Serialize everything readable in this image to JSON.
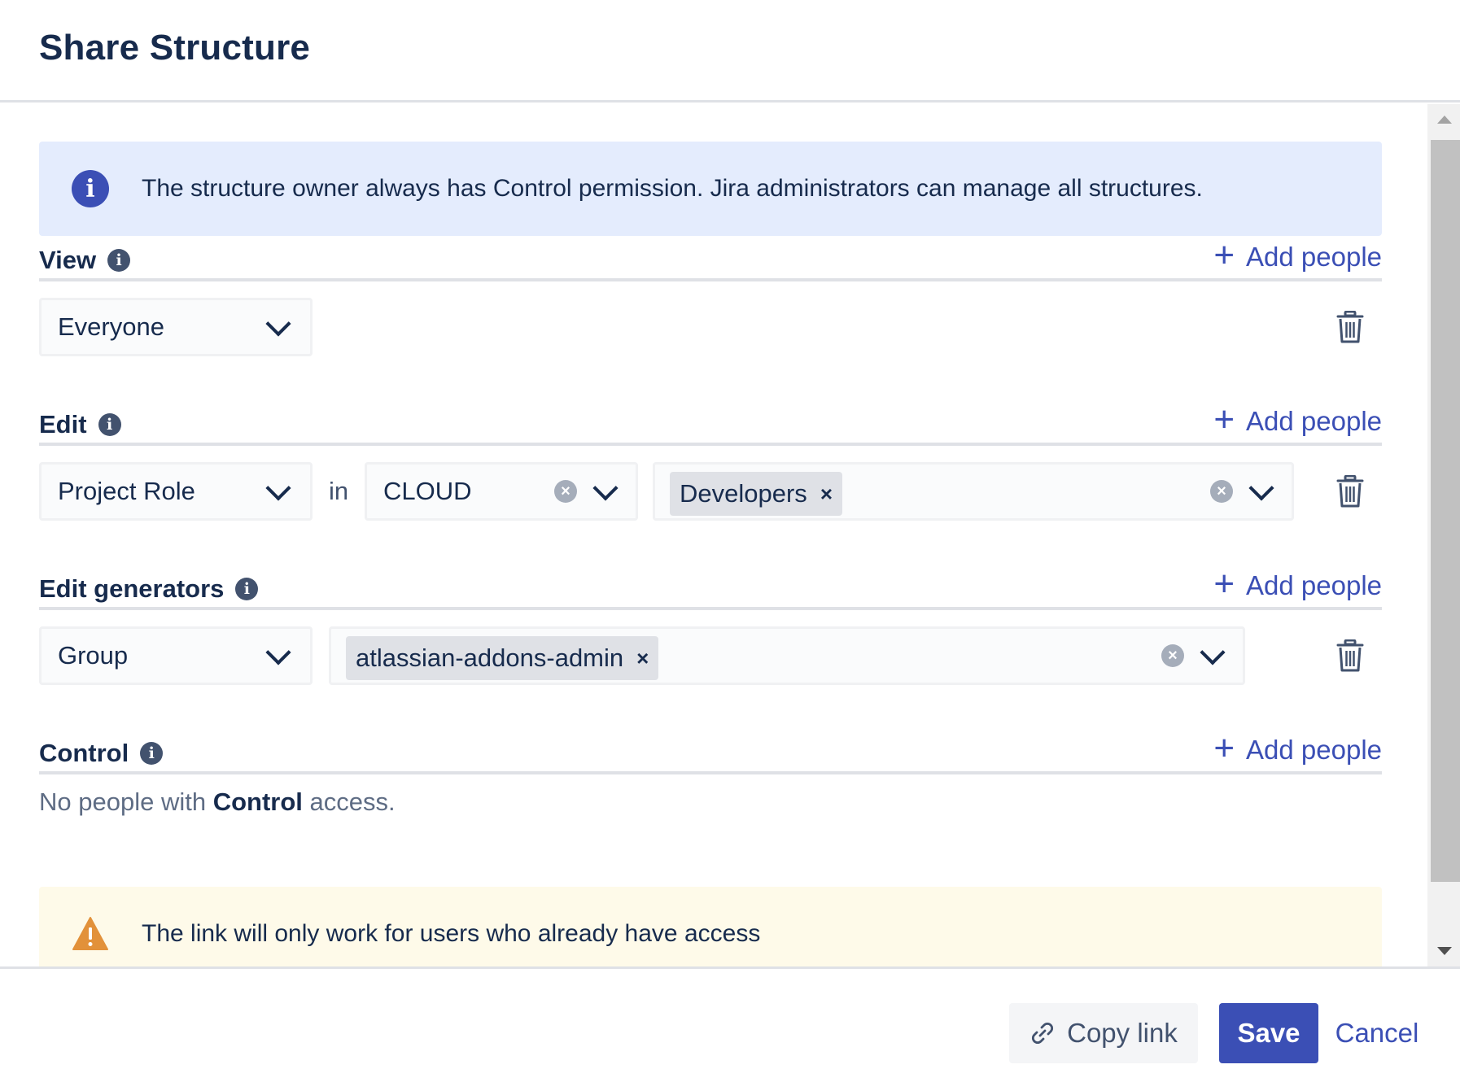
{
  "dialog": {
    "title": "Share Structure"
  },
  "info_banner": {
    "text": "The structure owner always has Control permission. Jira administrators can manage all structures."
  },
  "sections": {
    "view": {
      "title": "View",
      "add_label": "Add people",
      "type_select": "Everyone"
    },
    "edit": {
      "title": "Edit",
      "add_label": "Add people",
      "type_select": "Project Role",
      "in_label": "in",
      "project_select": "CLOUD",
      "role_tag": "Developers",
      "tag_remove": "×"
    },
    "edit_generators": {
      "title": "Edit generators",
      "add_label": "Add people",
      "type_select": "Group",
      "group_tag": "atlassian-addons-admin",
      "tag_remove": "×"
    },
    "control": {
      "title": "Control",
      "add_label": "Add people",
      "empty_prefix": "No people with",
      "empty_bold": "Control",
      "empty_suffix": "access."
    }
  },
  "warning_banner": {
    "text": "The link will only work for users who already have access"
  },
  "footer": {
    "copy_link": "Copy link",
    "save": "Save",
    "cancel": "Cancel"
  },
  "icons": {
    "info": "info-icon",
    "warning": "warning-icon",
    "plus": "plus-icon",
    "trash": "trash-icon",
    "chevron": "chevron-down-icon",
    "clear": "clear-icon",
    "link": "link-icon"
  },
  "colors": {
    "primary": "#3b4fb5",
    "info_bg": "#e4ecfd",
    "warn_bg": "#fefae9",
    "warn_icon": "#e2913a",
    "text": "#172b4d"
  }
}
